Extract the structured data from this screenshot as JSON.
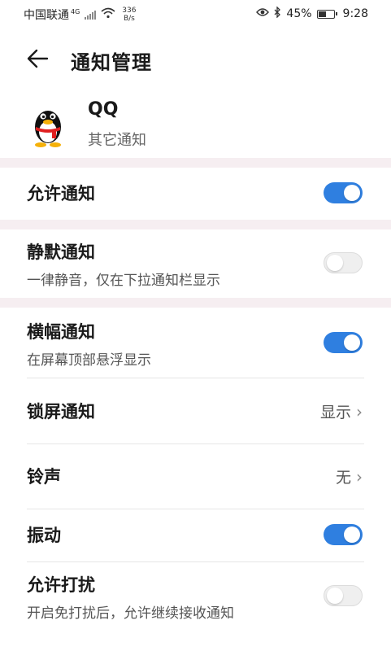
{
  "status_bar": {
    "carrier": "中国联通",
    "network": "4G",
    "speed_value": "336",
    "speed_unit": "B/s",
    "battery": "45%",
    "time": "9:28",
    "icons": [
      "wifi-icon",
      "eye-icon",
      "bluetooth-icon",
      "battery-icon"
    ]
  },
  "header": {
    "title": "通知管理",
    "back_icon": "arrow-left-icon"
  },
  "app": {
    "name": "QQ",
    "subtitle": "其它通知",
    "icon": "qq-penguin-icon"
  },
  "settings": [
    {
      "label": "允许通知",
      "type": "toggle",
      "on": true
    },
    {
      "label": "静默通知",
      "desc": "一律静音，仅在下拉通知栏显示",
      "type": "toggle",
      "on": false
    },
    {
      "label": "横幅通知",
      "desc": "在屏幕顶部悬浮显示",
      "type": "toggle",
      "on": true
    },
    {
      "label": "锁屏通知",
      "type": "select",
      "value": "显示"
    },
    {
      "label": "铃声",
      "type": "select",
      "value": "无"
    },
    {
      "label": "振动",
      "type": "toggle",
      "on": true
    },
    {
      "label": "允许打扰",
      "desc": "开启免打扰后，允许继续接收通知",
      "type": "toggle",
      "on": false
    }
  ],
  "colors": {
    "accent": "#2f7fe0",
    "separator": "#f6eef1"
  }
}
